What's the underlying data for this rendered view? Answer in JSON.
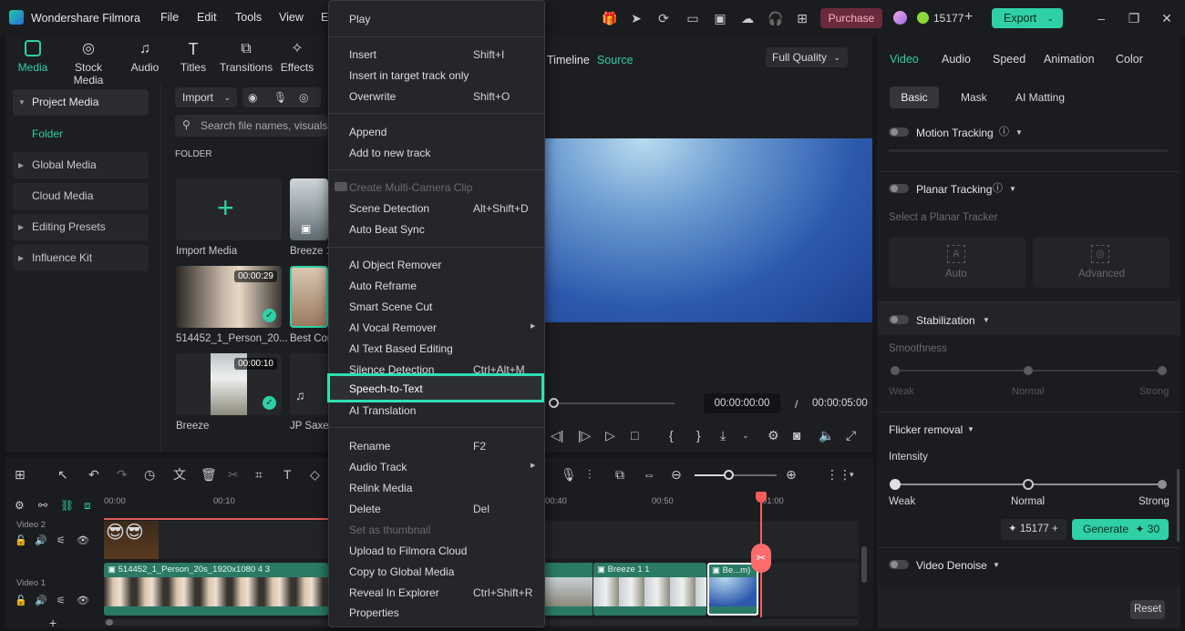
{
  "app": {
    "title": "Wondershare Filmora",
    "menus": [
      "File",
      "Edit",
      "Tools",
      "View",
      "E"
    ],
    "purchase": "Purchase",
    "credits": "15177",
    "export": "Export"
  },
  "toolbar": {
    "tabs": [
      "Media",
      "Stock Media",
      "Audio",
      "Titles",
      "Transitions",
      "Effects"
    ]
  },
  "sidebar": {
    "items": [
      {
        "label": "Project Media"
      },
      {
        "label": "Folder"
      },
      {
        "label": "Global Media"
      },
      {
        "label": "Cloud Media"
      },
      {
        "label": "Editing Presets"
      },
      {
        "label": "Influence Kit"
      }
    ]
  },
  "media": {
    "import_label": "Import",
    "search_placeholder": "Search file names, visuals, a",
    "folder_label": "FOLDER",
    "items": [
      {
        "name": "Import Media"
      },
      {
        "name": "Breeze 1"
      },
      {
        "name": "514452_1_Person_20...",
        "duration": "00:00:29"
      },
      {
        "name": "Best Cor"
      },
      {
        "name": "Breeze",
        "duration": "00:00:10"
      },
      {
        "name": "JP Saxe -"
      }
    ]
  },
  "player": {
    "timeline_tab": "Timeline",
    "source_tab": "Source",
    "quality": "Full Quality",
    "current_time": "00:00:00:00",
    "separator": "/",
    "total_time": "00:00:05:00"
  },
  "context_menu": {
    "items": [
      {
        "label": "Play"
      },
      {
        "label": "Insert",
        "shortcut": "Shift+I"
      },
      {
        "label": "Insert in target track only"
      },
      {
        "label": "Overwrite",
        "shortcut": "Shift+O"
      },
      {
        "label": "Append"
      },
      {
        "label": "Add to new track"
      },
      {
        "label": "Create Multi-Camera Clip"
      },
      {
        "label": "Scene Detection",
        "shortcut": "Alt+Shift+D"
      },
      {
        "label": "Auto Beat Sync"
      },
      {
        "label": "AI Object Remover"
      },
      {
        "label": "Auto Reframe"
      },
      {
        "label": "Smart Scene Cut"
      },
      {
        "label": "AI Vocal Remover"
      },
      {
        "label": "AI Text Based Editing"
      },
      {
        "label": "Silence Detection",
        "shortcut": "Ctrl+Alt+M"
      },
      {
        "label": "Speech-to-Text"
      },
      {
        "label": "AI Translation"
      },
      {
        "label": "Rename",
        "shortcut": "F2"
      },
      {
        "label": "Audio Track"
      },
      {
        "label": "Relink Media"
      },
      {
        "label": "Delete",
        "shortcut": "Del"
      },
      {
        "label": "Set as thumbnail"
      },
      {
        "label": "Upload to Filmora Cloud"
      },
      {
        "label": "Copy to Global Media"
      },
      {
        "label": "Reveal In Explorer",
        "shortcut": "Ctrl+Shift+R"
      },
      {
        "label": "Properties"
      }
    ]
  },
  "timeline": {
    "ruler": [
      "00:00",
      "00:10",
      "00:40",
      "00:50",
      "01:00"
    ],
    "tracks": [
      {
        "name": "Video 2"
      },
      {
        "name": "Video 1"
      }
    ],
    "clips": [
      {
        "label": "514452_1_Person_20s_1920x1080 4 3"
      },
      {
        "label": "Breeze 1 1"
      },
      {
        "label": "Be...m)"
      }
    ]
  },
  "right_panel": {
    "tabs": [
      "Video",
      "Audio",
      "Speed",
      "Animation",
      "Color"
    ],
    "subtabs": [
      "Basic",
      "Mask",
      "AI Matting"
    ],
    "motion_tracking": "Motion Tracking",
    "planar_tracking": "Planar Tracking",
    "planar_placeholder": "Select a Planar Tracker",
    "planar_auto": "Auto",
    "planar_advanced": "Advanced",
    "stabilization": "Stabilization",
    "smoothness": "Smoothness",
    "levels": [
      "Weak",
      "Normal",
      "Strong"
    ],
    "flicker": "Flicker removal",
    "intensity": "Intensity",
    "credits": "15177",
    "generate": "Generate",
    "generate_cost": "30",
    "video_denoise": "Video Denoise",
    "reset": "Reset"
  }
}
